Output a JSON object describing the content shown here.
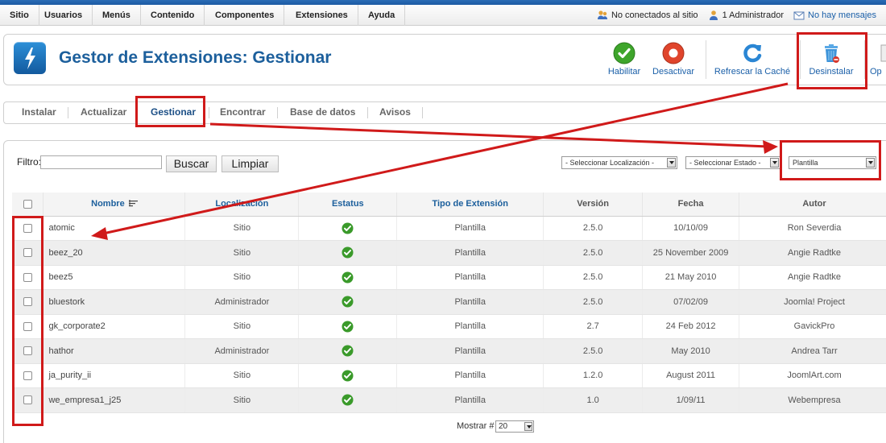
{
  "menu": [
    {
      "id": "sitio",
      "label": "Sitio"
    },
    {
      "id": "usuarios",
      "label": "Usuarios"
    },
    {
      "id": "menus",
      "label": "Menús"
    },
    {
      "id": "contenido",
      "label": "Contenido"
    },
    {
      "id": "componentes",
      "label": "Componentes"
    },
    {
      "id": "extensiones",
      "label": "Extensiones"
    },
    {
      "id": "ayuda",
      "label": "Ayuda"
    }
  ],
  "status": {
    "visitors": "No conectados al sitio",
    "admins": "1 Administrador",
    "messages": "No hay mensajes"
  },
  "page": {
    "title": "Gestor de Extensiones: Gestionar",
    "logo_icon": "extension-lightning-icon"
  },
  "toolbar": {
    "enable": "Habilitar",
    "disable": "Desactivar",
    "refresh": "Refrescar la Caché",
    "uninstall": "Desinstalar",
    "options": "Op"
  },
  "submenu": [
    {
      "id": "instalar",
      "label": "Instalar"
    },
    {
      "id": "actualizar",
      "label": "Actualizar"
    },
    {
      "id": "gestionar",
      "label": "Gestionar"
    },
    {
      "id": "encontrar",
      "label": "Encontrar"
    },
    {
      "id": "base-datos",
      "label": "Base de datos"
    },
    {
      "id": "avisos",
      "label": "Avisos"
    }
  ],
  "filter": {
    "label": "Filtro:",
    "value": "",
    "search": "Buscar",
    "clear": "Limpiar",
    "location_select": "- Seleccionar Localización -",
    "state_select": "- Seleccionar Estado -",
    "type_select": "Plantilla"
  },
  "table": {
    "headers": {
      "name": "Nombre",
      "location": "Localización",
      "status": "Estatus",
      "type": "Tipo de Extensión",
      "version": "Versión",
      "date": "Fecha",
      "author": "Autor"
    },
    "rows": [
      {
        "name": "atomic",
        "location": "Sitio",
        "type": "Plantilla",
        "version": "2.5.0",
        "date": "10/10/09",
        "author": "Ron Severdia"
      },
      {
        "name": "beez_20",
        "location": "Sitio",
        "type": "Plantilla",
        "version": "2.5.0",
        "date": "25 November 2009",
        "author": "Angie Radtke"
      },
      {
        "name": "beez5",
        "location": "Sitio",
        "type": "Plantilla",
        "version": "2.5.0",
        "date": "21 May 2010",
        "author": "Angie Radtke"
      },
      {
        "name": "bluestork",
        "location": "Administrador",
        "type": "Plantilla",
        "version": "2.5.0",
        "date": "07/02/09",
        "author": "Joomla! Project"
      },
      {
        "name": "gk_corporate2",
        "location": "Sitio",
        "type": "Plantilla",
        "version": "2.7",
        "date": "24 Feb 2012",
        "author": "GavickPro"
      },
      {
        "name": "hathor",
        "location": "Administrador",
        "type": "Plantilla",
        "version": "2.5.0",
        "date": "May 2010",
        "author": "Andrea Tarr"
      },
      {
        "name": "ja_purity_ii",
        "location": "Sitio",
        "type": "Plantilla",
        "version": "1.2.0",
        "date": "August 2011",
        "author": "JoomlArt.com"
      },
      {
        "name": "we_empresa1_j25",
        "location": "Sitio",
        "type": "Plantilla",
        "version": "1.0",
        "date": "1/09/11",
        "author": "Webempresa"
      }
    ]
  },
  "pagination": {
    "label": "Mostrar #",
    "value": "20"
  },
  "colors": {
    "brand_blue": "#1c5f9c",
    "highlight_red": "#d01a1a",
    "status_green": "#3a9a2a"
  }
}
